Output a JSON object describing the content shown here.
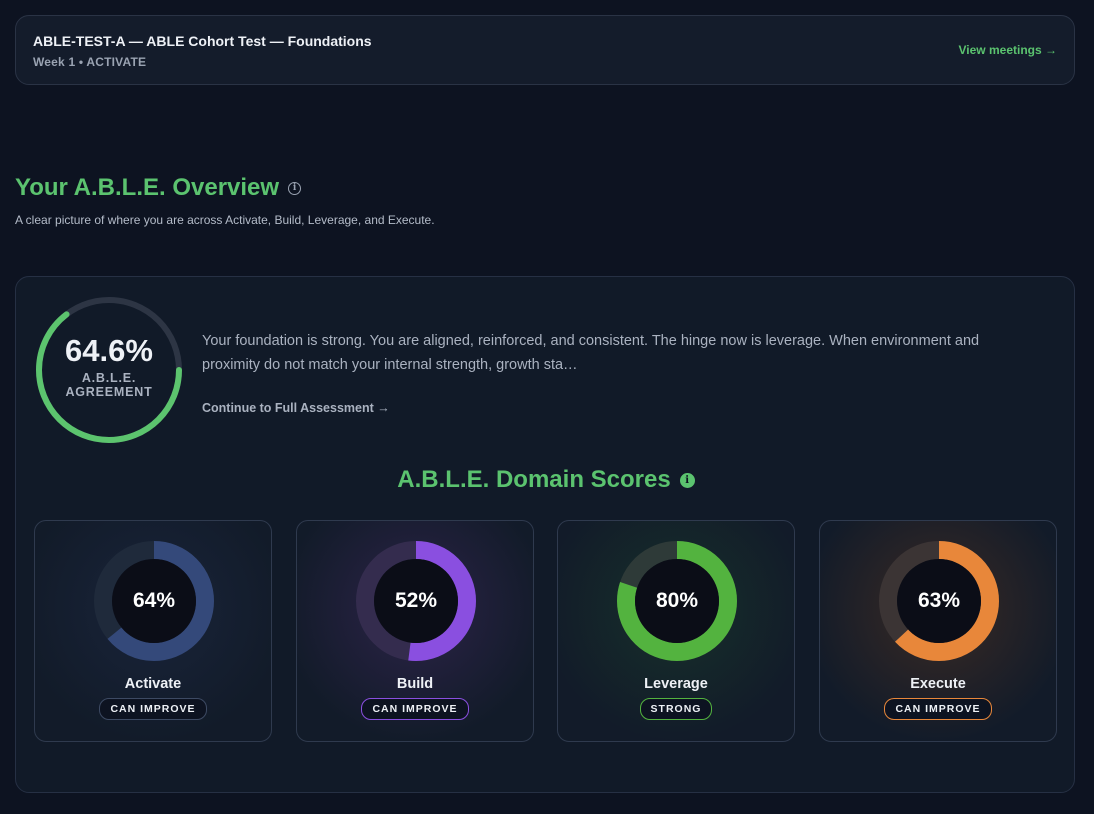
{
  "header": {
    "course_title": "ABLE-TEST-A — ABLE Cohort Test — Foundations",
    "course_subtitle": "Week 1 • ACTIVATE",
    "view_meetings": "View meetings →"
  },
  "overview": {
    "title": "Your A.B.L.E. Overview",
    "info_glyph": "i",
    "subtitle": "A clear picture of where you are across Activate, Build, Leverage, and Execute."
  },
  "agreement": {
    "value_text": "64.6%",
    "value": 64.6,
    "label_line1": "A.B.L.E.",
    "label_line2": "AGREEMENT",
    "ring_color": "#5cc46e",
    "track_color": "#2d3544"
  },
  "summary": {
    "text": "Your foundation is strong. You are aligned, reinforced, and consistent. The hinge now is leverage. When environment and proximity do not match your internal strength, growth sta…",
    "continue_link": "Continue to Full Assessment →"
  },
  "domain_scores": {
    "title": "A.B.L.E. Domain Scores",
    "info_glyph": "i",
    "domains": [
      {
        "name": "Activate",
        "value": 64,
        "value_text": "64%",
        "status": "CAN IMPROVE",
        "color": "#34497a",
        "track": "#1f2a3b",
        "badge_border": "#3d4a63",
        "glow": "#19243a"
      },
      {
        "name": "Build",
        "value": 52,
        "value_text": "52%",
        "status": "CAN IMPROVE",
        "color": "#8a4fe0",
        "track": "#342c4e",
        "badge_border": "#8a4fe0",
        "glow": "#2c2348"
      },
      {
        "name": "Leverage",
        "value": 80,
        "value_text": "80%",
        "status": "STRONG",
        "color": "#53b33f",
        "track": "#2e3a38",
        "badge_border": "#53b33f",
        "glow": "#17302a"
      },
      {
        "name": "Execute",
        "value": 63,
        "value_text": "63%",
        "status": "CAN IMPROVE",
        "color": "#e8873a",
        "track": "#3b3434",
        "badge_border": "#e8873a",
        "glow": "#3a2a24"
      }
    ]
  }
}
